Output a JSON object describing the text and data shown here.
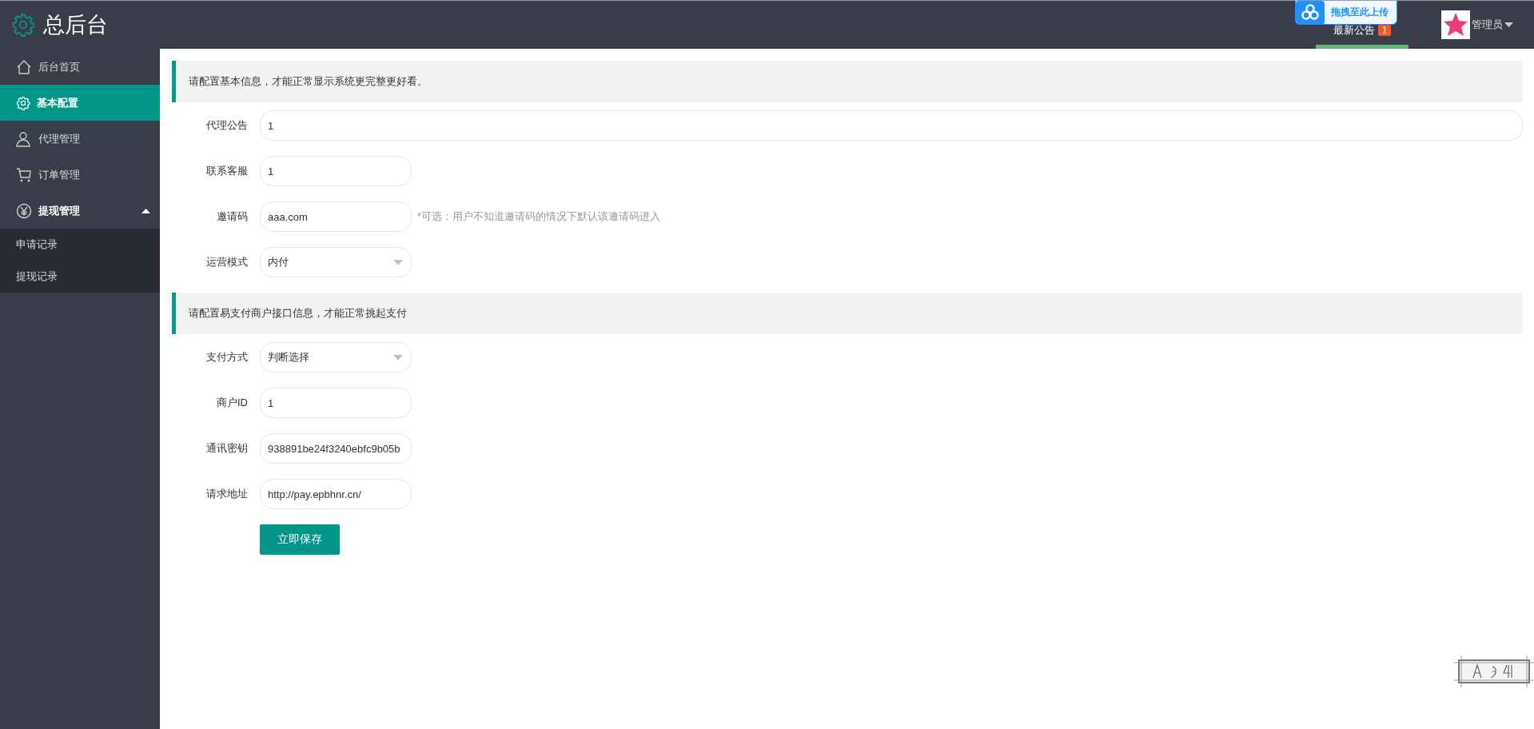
{
  "header": {
    "title": "总后台",
    "notice": {
      "label": "最新公告",
      "count": "1",
      "selected": true
    },
    "user": {
      "name": "管理员"
    },
    "upload_overlay": {
      "label": "拖拽至此上传"
    }
  },
  "sidebar": {
    "items": [
      {
        "label": "后台首页",
        "selected": false
      },
      {
        "label": "基本配置",
        "selected": true
      },
      {
        "label": "代理管理",
        "selected": false
      },
      {
        "label": "订单管理",
        "selected": false
      },
      {
        "label": "提现管理",
        "selected": false,
        "expanded": true,
        "children": [
          {
            "label": "申请记录",
            "selected": false
          },
          {
            "label": "提现记录",
            "selected": false
          }
        ]
      }
    ]
  },
  "sections": [
    {
      "notice": "请配置基本信息，才能正常显示系统更完整更好看。",
      "fields": [
        {
          "label": "代理公告",
          "kind": "text",
          "value": "1",
          "wide": true
        },
        {
          "label": "联系客服",
          "kind": "text",
          "value": "1"
        },
        {
          "label": "邀请码",
          "kind": "text",
          "value": "aaa.com",
          "hint": "*可选：用户不知道邀请码的情况下默认该邀请码进入"
        },
        {
          "label": "运营模式",
          "kind": "select",
          "value": "内付"
        }
      ]
    },
    {
      "notice": "请配置易支付商户接口信息，才能正常挑起支付",
      "fields": [
        {
          "label": "支付方式",
          "kind": "select",
          "value": "判断选择"
        },
        {
          "label": "商户ID",
          "kind": "text",
          "value": "1"
        },
        {
          "label": "通讯密钥",
          "kind": "text",
          "value": "938891be24f3240ebfc9b05b"
        },
        {
          "label": "请求地址",
          "kind": "text",
          "value": "http://pay.epbhnr.cn/"
        }
      ]
    }
  ],
  "save_button": "立即保存"
}
